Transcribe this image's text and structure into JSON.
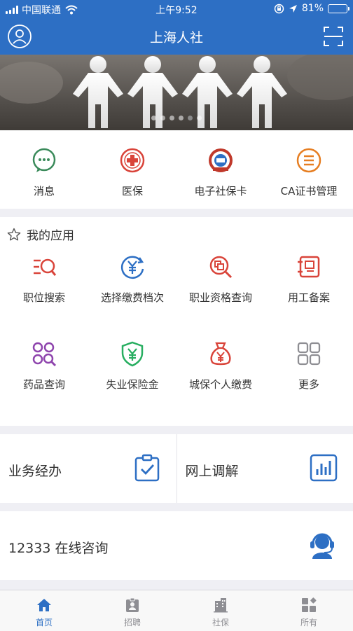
{
  "status_bar": {
    "carrier": "中国联通",
    "time": "上午9:52",
    "battery": "81%",
    "battery_level": 0.81
  },
  "nav": {
    "title": "上海人社",
    "left_icon": "user-icon",
    "right_icon": "scan-icon"
  },
  "banner": {
    "slides": 6,
    "active_slide": 5
  },
  "quick_items": [
    {
      "label": "消息",
      "icon": "message-icon",
      "color": "#3a8a5a"
    },
    {
      "label": "医保",
      "icon": "medical-cross-icon",
      "color": "#d9443a"
    },
    {
      "label": "电子社保卡",
      "icon": "social-security-card-icon",
      "color": "#c0392b"
    },
    {
      "label": "CA证书管理",
      "icon": "certificate-list-icon",
      "color": "#e67e22"
    }
  ],
  "my_apps": {
    "title": "我的应用",
    "items": [
      {
        "label": "职位搜索",
        "icon": "job-search-icon",
        "color": "#d9443a"
      },
      {
        "label": "选择缴费档次",
        "icon": "yuan-cycle-icon",
        "color": "#2d6fc4"
      },
      {
        "label": "职业资格查询",
        "icon": "qualification-search-icon",
        "color": "#d9443a"
      },
      {
        "label": "用工备案",
        "icon": "employment-record-icon",
        "color": "#d9443a"
      },
      {
        "label": "药品查询",
        "icon": "drug-search-icon",
        "color": "#8e44ad"
      },
      {
        "label": "失业保险金",
        "icon": "insurance-shield-icon",
        "color": "#27ae60"
      },
      {
        "label": "城保个人缴费",
        "icon": "money-bag-icon",
        "color": "#d9443a"
      },
      {
        "label": "更多",
        "icon": "more-grid-icon",
        "color": "#8e8e93"
      }
    ]
  },
  "cards": [
    {
      "label": "业务经办",
      "icon": "clipboard-check-icon"
    },
    {
      "label": "网上调解",
      "icon": "bar-chart-icon"
    }
  ],
  "consult": {
    "label": "12333 在线咨询",
    "icon": "headset-agent-icon"
  },
  "tabs": [
    {
      "label": "首页",
      "icon": "home-icon",
      "active": true
    },
    {
      "label": "招聘",
      "icon": "badge-icon",
      "active": false
    },
    {
      "label": "社保",
      "icon": "building-icon",
      "active": false
    },
    {
      "label": "所有",
      "icon": "grid-icon",
      "active": false
    }
  ],
  "colors": {
    "brand": "#2d6fc4",
    "page_bg": "#efeff4",
    "tab_inactive": "#8e8e93"
  }
}
